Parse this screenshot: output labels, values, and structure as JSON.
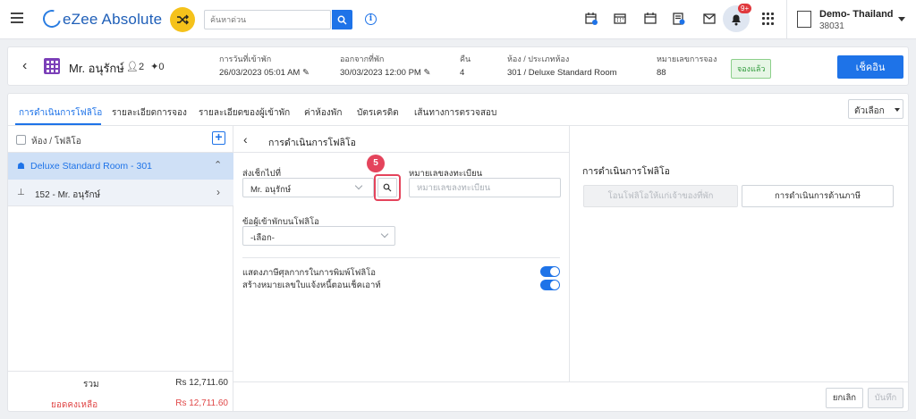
{
  "app": {
    "title": "eZee Absolute",
    "search_placeholder": "ค้นหาด่วน",
    "notifications_count": "9+",
    "hotel_name": "Demo- Thailand",
    "hotel_code": "38031"
  },
  "guest": {
    "name": "Mr. อนุรักษ์",
    "adults": "2",
    "children": "0",
    "arrival_label": "การวันที่เข้าพัก",
    "arrival_value": "26/03/2023 05:01 AM",
    "departure_label": "ออกจากที่พัก",
    "departure_value": "30/03/2023 12:00 PM",
    "nights_label": "คืน",
    "nights_value": "4",
    "room_label": "ห้อง / ประเภทห้อง",
    "room_value": "301 / Deluxe Standard Room",
    "reservation_label": "หมายเลขการจอง",
    "reservation_value": "88",
    "status": "จองแล้ว",
    "checkin_button": "เช็คอิน"
  },
  "tabs": [
    {
      "label": "การดำเนินการโฟลิโอ"
    },
    {
      "label": "รายละเอียดการจอง"
    },
    {
      "label": "รายละเอียดของผู้เข้าพัก"
    },
    {
      "label": "ค่าห้องพัก"
    },
    {
      "label": "บัตรเครดิต"
    },
    {
      "label": "เส้นทางการตรวจสอบ"
    }
  ],
  "options_button": "ตัวเลือก",
  "left_panel": {
    "header": "ห้อง / โฟลิโอ",
    "room": "Deluxe Standard Room - 301",
    "folio": "152 - Mr. อนุรักษ์",
    "total_label": "รวม",
    "total_value": "Rs 12,711.60",
    "balance_label": "ยอดคงเหลือ",
    "balance_value": "Rs 12,711.60"
  },
  "folio_ops": {
    "title": "การดำเนินการโฟลิโอ",
    "send_to_label": "ส่งเช็กไปที่",
    "send_to_value": "Mr. อนุรักษ์",
    "step_number": "5",
    "reg_no_label": "หมายเลขลงทะเบียน",
    "reg_no_placeholder": "หมายเลขลงทะเบียน",
    "guest_on_folio_label": "ข้อผู้เข้าพักบนโฟลิโอ",
    "guest_on_folio_value": "-เลือก-",
    "toggle1_label": "แสดงภาษีศุลกากรในการพิมพ์โฟลิโอ",
    "toggle2_label": "สร้างหมายเลขใบแจ้งหนี้ตอนเช็คเอาท์",
    "toggle1_on": true,
    "toggle2_on": true
  },
  "right_panel": {
    "title": "การดำเนินการโฟลิโอ",
    "transfer_button": "โอนโฟลิโอให้แก่เจ้าของที่พัก",
    "tax_button": "การดำเนินการด้านภาษี"
  },
  "footer": {
    "cancel": "ยกเลิก",
    "save": "บันทึก"
  },
  "colors": {
    "accent": "#1e73e8",
    "highlight": "#e4445c",
    "status_green": "#2e9a3a",
    "balance_red": "#e04848"
  }
}
